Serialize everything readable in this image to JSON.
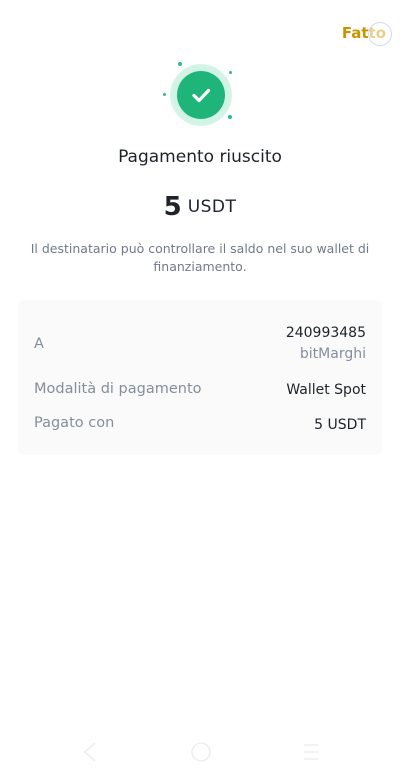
{
  "header": {
    "done_label": "Fatto"
  },
  "status": {
    "title": "Pagamento riuscito",
    "amount": "5",
    "unit": "USDT",
    "note": "Il destinatario può controllare il saldo nel suo wallet di finanziamento."
  },
  "details": {
    "recipient": {
      "label": "A",
      "id": "240993485",
      "name": "bitMarghi"
    },
    "method": {
      "label": "Modalità di pagamento",
      "value": "Wallet Spot"
    },
    "paid_with": {
      "label": "Pagato con",
      "value": "5 USDT"
    }
  },
  "nav": {
    "icons": [
      "back-icon",
      "home-icon",
      "menu-icon"
    ]
  },
  "colors": {
    "accent": "#c99400",
    "success": "#1fb57a"
  }
}
